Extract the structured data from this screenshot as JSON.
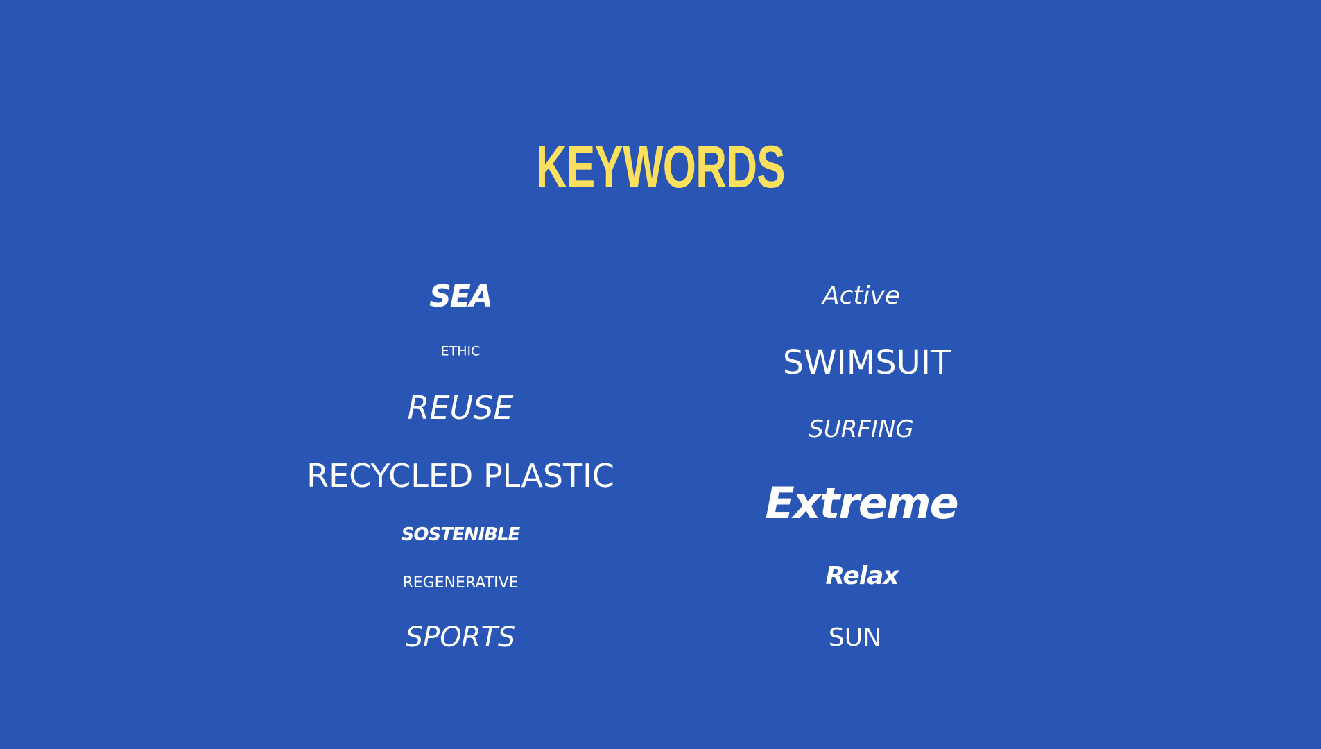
{
  "title": "KEYWORDS",
  "colors": {
    "background": "#2955b4",
    "title": "#fbe05d",
    "keyword": "#ffffff"
  },
  "keywords": {
    "left": [
      "SEA",
      "ETHIC",
      "REUSE",
      "RECYCLED PLASTIC",
      "SOSTENIBLE",
      "REGENERATIVE",
      "SPORTS"
    ],
    "right": [
      "Active",
      "SWIMSUIT",
      "SURFING",
      "Extreme",
      "Relax",
      "SUN"
    ]
  }
}
